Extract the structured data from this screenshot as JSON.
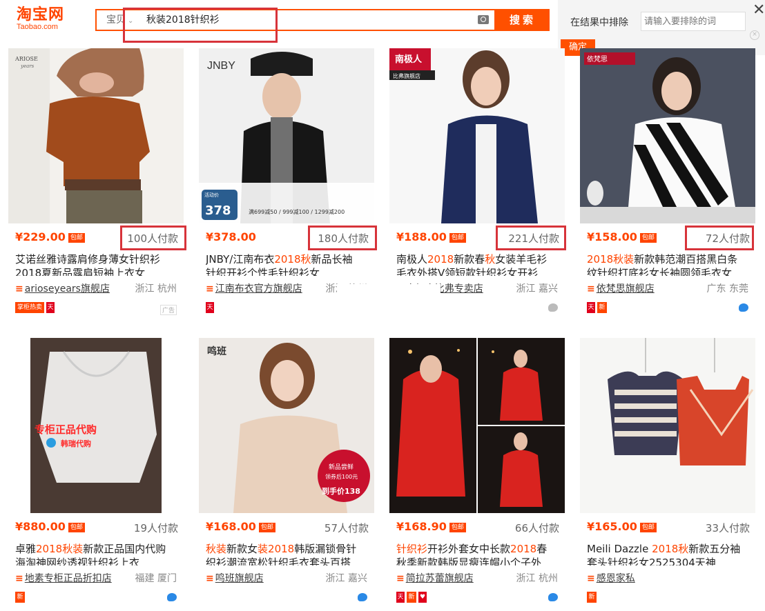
{
  "header": {
    "logo_cn": "淘宝网",
    "logo_en": "Taobao.com",
    "category": "宝贝",
    "query": "秋装2018针织衫",
    "search_btn": "搜索",
    "exclude_label": "在结果中排除",
    "exclude_placeholder": "请输入要排除的词",
    "confirm_btn": "确定",
    "close": "✕"
  },
  "colors": {
    "brand": "#ff5000",
    "price": "#ff4400",
    "highlight_box": "#d7333a"
  },
  "products": [
    {
      "price": "¥229.00",
      "badge": "包邮",
      "sales": "100人付款",
      "title_parts": [
        "艾诺丝雅诗露肩修身薄女针织衫",
        "",
        "",
        "",
        "2018夏新品露肩短袖上衣女"
      ],
      "shop": "arioseyears旗舰店",
      "location": "浙江 杭州",
      "tags": [
        "掌柜热卖",
        "天"
      ],
      "ad": "广告",
      "img_text": "ARIOSE years"
    },
    {
      "price": "¥378.00",
      "badge": "",
      "sales": "180人付款",
      "title_parts": [
        "JNBY/江南布衣",
        "2018",
        "",
        "秋",
        "新品长袖"
      ],
      "title_line2": "针织开衫个性毛针织衫女",
      "shop": "江南布衣官方旗舰店",
      "location": "浙江 杭州",
      "tags": [
        "天"
      ],
      "img_text": "JNBY",
      "img_price": "378",
      "img_promo": "满699减50 / 999减100 / 1299减200",
      "img_label": "活动价"
    },
    {
      "price": "¥188.00",
      "badge": "包邮",
      "sales": "221人付款",
      "title_parts": [
        "南极人",
        "2018",
        "新款春",
        "秋",
        "女装羊毛衫"
      ],
      "title_line2": "毛衣外搭V领短款针织衫女开衫",
      "shop": "南极人比弗专卖店",
      "location": "浙江 嘉兴",
      "tags": [],
      "img_text": "南极人",
      "img_sub": "比弗旗舰店"
    },
    {
      "price": "¥158.00",
      "badge": "包邮",
      "sales": "72人付款",
      "title_parts": [
        "",
        "2018秋装",
        "新款韩范潮百搭黑白条",
        "",
        ""
      ],
      "title_line2": "纹针织打底衫女长袖圆领毛衣女",
      "shop": "依梵思旗舰店",
      "location": "广东 东莞",
      "tags": [
        "天",
        "新"
      ],
      "img_text": "依梵思"
    },
    {
      "price": "¥880.00",
      "badge": "包邮",
      "sales": "19人付款",
      "title_parts": [
        "卓雅",
        "2018秋装",
        "新款正品国内代购",
        "",
        ""
      ],
      "title_line2": "海淘神网纱透视针织衫上衣",
      "shop": "地素专柜正品折扣店",
      "location": "福建 厦门",
      "tags": [
        "新"
      ],
      "img_text": "专柜正品代购",
      "img_sub": "韩瑞代购"
    },
    {
      "price": "¥168.00",
      "badge": "包邮",
      "sales": "57人付款",
      "title_parts": [
        "",
        "秋装",
        "新款女",
        "装2018",
        "韩版漏锁骨针"
      ],
      "title_line2": "织衫潮流宽松针织毛衣套头百搭",
      "shop": "鸣班旗舰店",
      "location": "浙江 嘉兴",
      "tags": [],
      "img_text": "鸣班",
      "img_badge": "新品尝鲜",
      "img_badge2": "领券后100元",
      "img_price": "到手价138"
    },
    {
      "price": "¥168.90",
      "badge": "包邮",
      "sales": "66人付款",
      "title_parts": [
        "",
        "针织衫",
        "开衫外套女中长款",
        "2018",
        "春"
      ],
      "title_line2": "秋季新款韩版显瘦连帽小个子外",
      "shop": "简拉苏蕾旗舰店",
      "location": "浙江 杭州",
      "tags": [
        "天",
        "新",
        "♥"
      ]
    },
    {
      "price": "¥165.00",
      "badge": "包邮",
      "sales": "33人付款",
      "title_parts": [
        "Meili Dazzle ",
        "2018秋",
        "新款五分袖",
        "",
        ""
      ],
      "title_line2": "套头针织衫女2525304天神",
      "shop": "感恩家私",
      "location": "",
      "tags": [
        "新"
      ]
    }
  ]
}
